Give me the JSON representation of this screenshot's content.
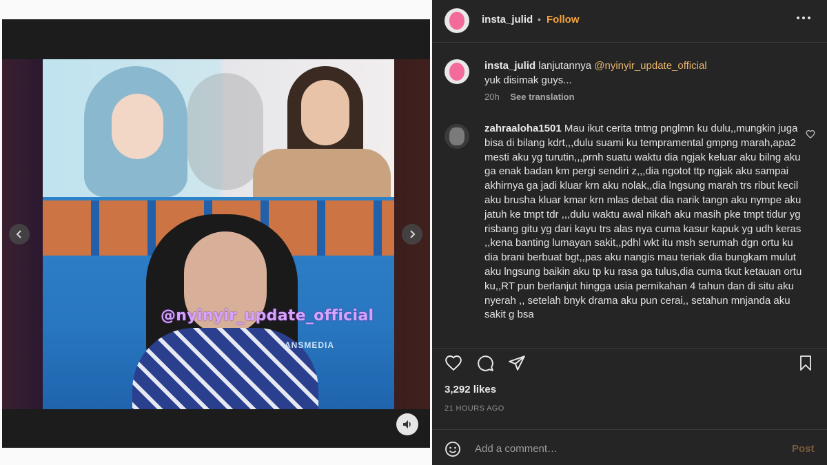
{
  "header": {
    "username": "insta_julid",
    "separator": "•",
    "follow_label": "Follow",
    "more_icon": "more-horizontal-icon"
  },
  "media": {
    "watermark": "@nyinyir_update_official",
    "broadcaster": "ANSMEDIA",
    "prev_icon": "chevron-left-icon",
    "next_icon": "chevron-right-icon",
    "mute_icon": "speaker-icon"
  },
  "caption": {
    "username": "insta_julid",
    "text_prefix": "lanjutannya ",
    "mention": "@nyinyir_update_official",
    "text_line2": "yuk disimak guys...",
    "age": "20h",
    "see_translation": "See translation"
  },
  "comment": {
    "username": "zahraaloha1501",
    "text": "Mau ikut cerita tntng pnglmn ku dulu,,mungkin juga bisa di bilang kdrt,,,dulu suami ku tempramental gmpng marah,apa2 mesti aku yg turutin,,,prnh suatu waktu dia ngjak keluar aku bilng aku ga enak badan km pergi sendiri z,,,dia ngotot ttp ngjak aku sampai akhirnya ga jadi kluar krn aku nolak,,dia lngsung marah trs ribut kecil aku brusha kluar kmar krn mlas debat dia narik tangn aku nympe aku jatuh ke tmpt tdr ,,,dulu waktu awal nikah aku masih pke tmpt tidur yg risbang gitu yg dari kayu trs alas nya cuma kasur kapuk yg udh keras ,,kena banting lumayan sakit,,pdhl wkt itu msh serumah dgn ortu ku dia brani berbuat bgt,,pas aku nangis mau teriak dia bungkam mulut aku lngsung baikin aku tp ku rasa ga tulus,dia cuma tkut ketauan ortu ku,,RT pun berlanjut hingga usia pernikahan 4 tahun dan di situ aku nyerah ,, setelah bnyk drama aku pun cerai,, setahun mnjanda aku sakit g bsa"
  },
  "stats": {
    "likes": "3,292 likes",
    "time": "21 HOURS AGO"
  },
  "add_comment": {
    "placeholder": "Add a comment…",
    "post_label": "Post"
  },
  "colors": {
    "panel_bg": "#252525",
    "follow": "#f5a340",
    "mention": "#e8b46a",
    "post_disabled": "#7a5a3a"
  }
}
